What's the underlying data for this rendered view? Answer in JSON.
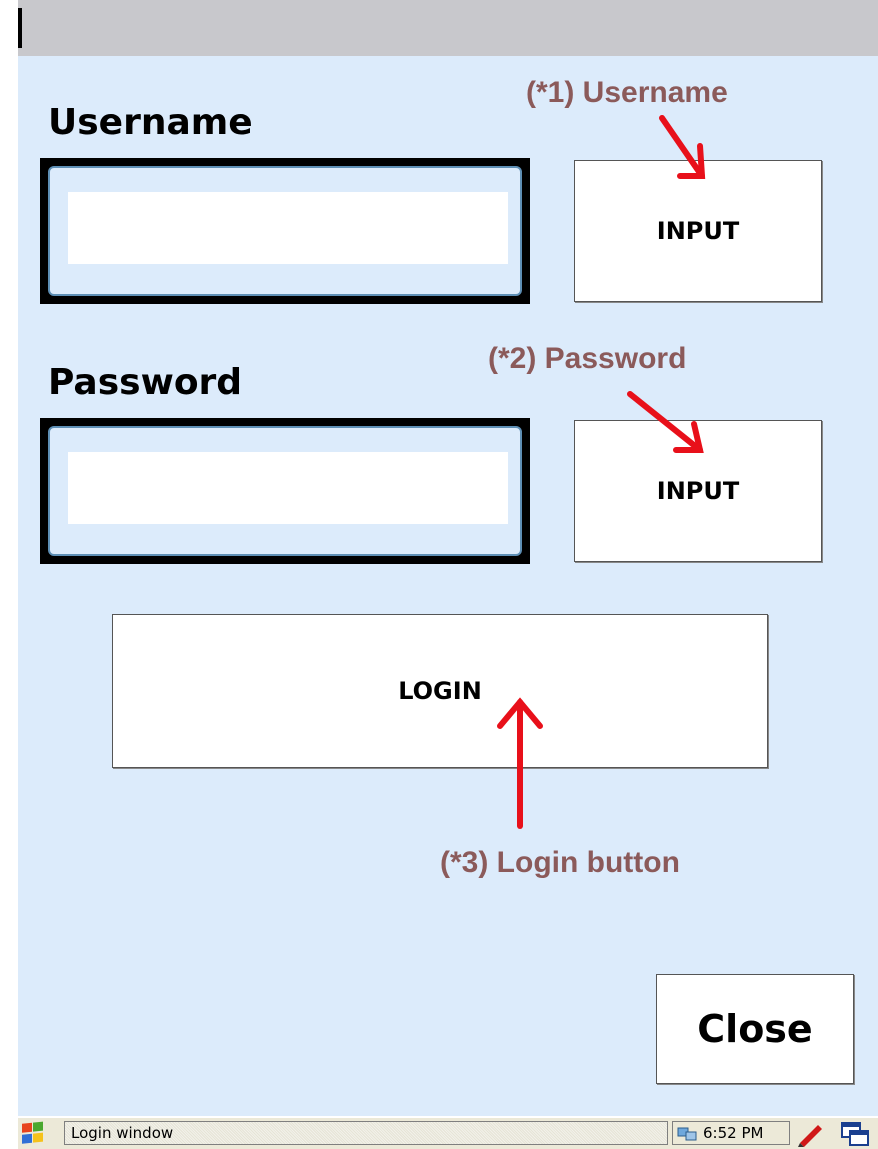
{
  "username": {
    "label": "Username",
    "value": "",
    "input_button": "INPUT"
  },
  "password": {
    "label": "Password",
    "value": "",
    "input_button": "INPUT"
  },
  "login_button": "LOGIN",
  "close_button": "Close",
  "annotations": {
    "username_note": "(*1) Username",
    "password_note": "(*2) Password",
    "login_note": "(*3) Login button",
    "color": "#8b5a5a",
    "arrow_color": "#e8101a"
  },
  "taskbar": {
    "task_label": "Login window",
    "clock": "6:52 PM",
    "icons": [
      "windows-start-icon",
      "network-icon",
      "pen-icon",
      "window-switch-icon"
    ]
  },
  "colors": {
    "client_bg": "#dcebfb",
    "titlebar_bg": "#c8c8cc",
    "taskbar_bg": "#ece9d8"
  }
}
